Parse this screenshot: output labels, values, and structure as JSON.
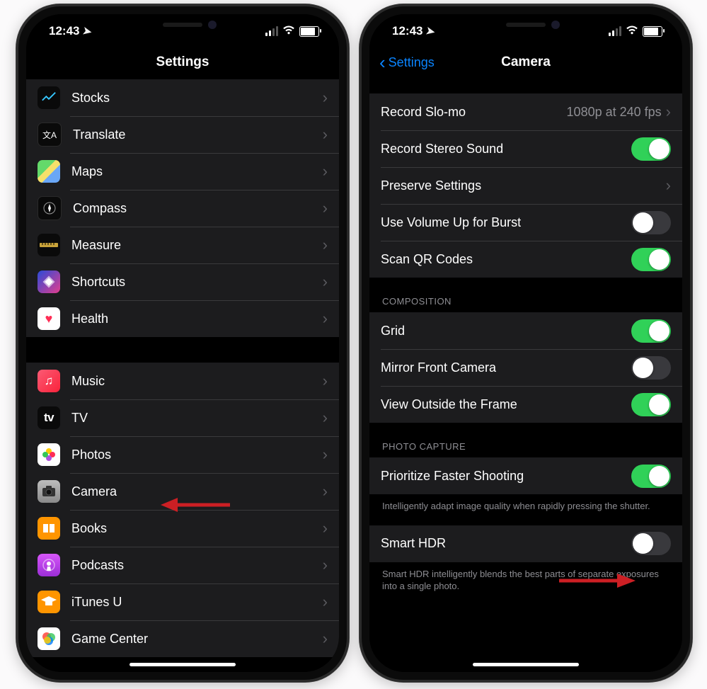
{
  "status": {
    "time": "12:43"
  },
  "left": {
    "nav": {
      "title": "Settings"
    },
    "group1": [
      {
        "id": "stocks",
        "label": "Stocks"
      },
      {
        "id": "translate",
        "label": "Translate"
      },
      {
        "id": "maps",
        "label": "Maps"
      },
      {
        "id": "compass",
        "label": "Compass"
      },
      {
        "id": "measure",
        "label": "Measure"
      },
      {
        "id": "shortcuts",
        "label": "Shortcuts"
      },
      {
        "id": "health",
        "label": "Health"
      }
    ],
    "group2": [
      {
        "id": "music",
        "label": "Music"
      },
      {
        "id": "tv",
        "label": "TV"
      },
      {
        "id": "photos",
        "label": "Photos"
      },
      {
        "id": "camera",
        "label": "Camera"
      },
      {
        "id": "books",
        "label": "Books"
      },
      {
        "id": "podcasts",
        "label": "Podcasts"
      },
      {
        "id": "itunesu",
        "label": "iTunes U"
      },
      {
        "id": "gamecenter",
        "label": "Game Center"
      }
    ]
  },
  "right": {
    "nav": {
      "back": "Settings",
      "title": "Camera"
    },
    "group_top": [
      {
        "id": "slomo",
        "label": "Record Slo-mo",
        "value": "1080p at 240 fps",
        "type": "link"
      },
      {
        "id": "stereo",
        "label": "Record Stereo Sound",
        "type": "toggle",
        "on": true
      },
      {
        "id": "preserve",
        "label": "Preserve Settings",
        "type": "link"
      },
      {
        "id": "volburst",
        "label": "Use Volume Up for Burst",
        "type": "toggle",
        "on": false
      },
      {
        "id": "qr",
        "label": "Scan QR Codes",
        "type": "toggle",
        "on": true
      }
    ],
    "composition_header": "COMPOSITION",
    "group_comp": [
      {
        "id": "grid",
        "label": "Grid",
        "type": "toggle",
        "on": true
      },
      {
        "id": "mirror",
        "label": "Mirror Front Camera",
        "type": "toggle",
        "on": false
      },
      {
        "id": "outside",
        "label": "View Outside the Frame",
        "type": "toggle",
        "on": true
      }
    ],
    "capture_header": "PHOTO CAPTURE",
    "group_cap1": [
      {
        "id": "faster",
        "label": "Prioritize Faster Shooting",
        "type": "toggle",
        "on": true
      }
    ],
    "cap1_footer": "Intelligently adapt image quality when rapidly pressing the shutter.",
    "group_cap2": [
      {
        "id": "hdr",
        "label": "Smart HDR",
        "type": "toggle",
        "on": false
      }
    ],
    "cap2_footer": "Smart HDR intelligently blends the best parts of separate exposures into a single photo."
  }
}
